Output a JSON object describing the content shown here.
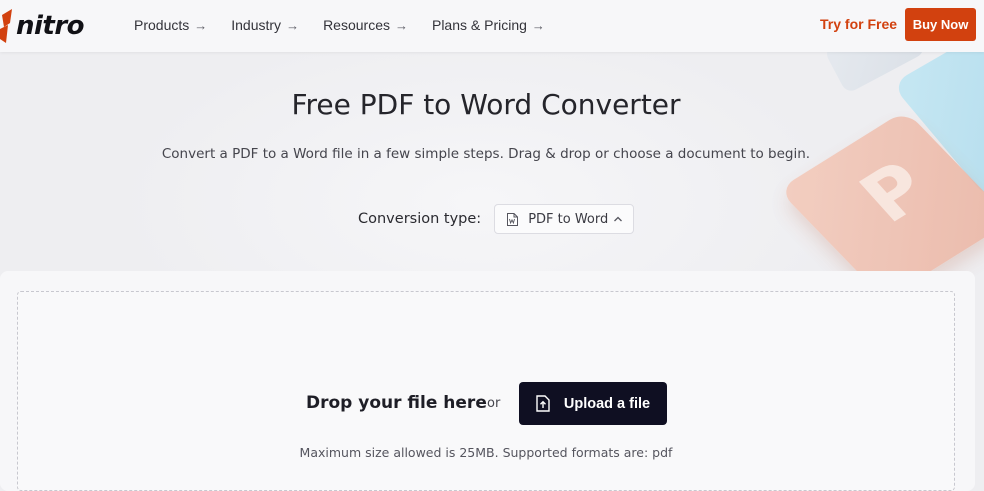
{
  "nav": {
    "brand": "nitro",
    "items": [
      {
        "label": "Products",
        "arrow": "→"
      },
      {
        "label": "Industry",
        "arrow": "→"
      },
      {
        "label": "Resources",
        "arrow": "→"
      },
      {
        "label": "Plans & Pricing",
        "arrow": "→"
      }
    ],
    "try_free": "Try for Free",
    "buy_now": "Buy Now"
  },
  "hero": {
    "title": "Free PDF to Word Converter",
    "subtitle": "Convert a PDF to a Word file in a few simple steps. Drag & drop or choose a document to begin.",
    "conversion_label": "Conversion type:",
    "conversion_value": "PDF to Word",
    "decor_letter": "P"
  },
  "dropzone": {
    "drop_text": "Drop your file here",
    "or_text": "or",
    "upload_label": "Upload a file",
    "note": "Maximum size allowed is 25MB. Supported formats are: pdf"
  },
  "colors": {
    "accent": "#d2410f",
    "dark_button": "#0f0f22",
    "page_bg": "#eeeef1"
  },
  "icons": {
    "dropdown_file": "word-file-icon",
    "dropdown_chevron": "chevron-up-icon",
    "upload": "upload-file-icon",
    "logo": "nitro-logo-icon"
  }
}
